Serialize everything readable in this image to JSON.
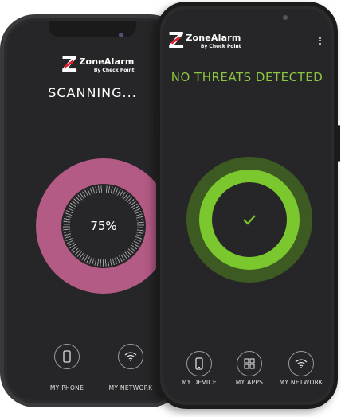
{
  "back_phone": {
    "logo": {
      "mark": "Z",
      "brand": "ZoneAlarm",
      "by": "By Check Point"
    },
    "title": "SCANNING...",
    "progress": {
      "value": 75,
      "label": "75%",
      "color": "#b35a85"
    },
    "nav": [
      {
        "label": "MY PHONE",
        "icon": "phone-icon"
      },
      {
        "label": "MY NETWORK",
        "icon": "wifi-icon"
      }
    ]
  },
  "front_phone": {
    "logo": {
      "mark": "Z",
      "brand": "ZoneAlarm",
      "by": "By Check Point"
    },
    "title": "NO THREATS DETECTED",
    "status": {
      "icon": "checkmark-icon",
      "color": "#7ac72e"
    },
    "menu_icon": "kebab-menu-icon",
    "nav": [
      {
        "label": "MY DEVICE",
        "icon": "phone-icon"
      },
      {
        "label": "MY APPS",
        "icon": "apps-icon"
      },
      {
        "label": "MY NETWORK",
        "icon": "wifi-icon"
      }
    ]
  }
}
